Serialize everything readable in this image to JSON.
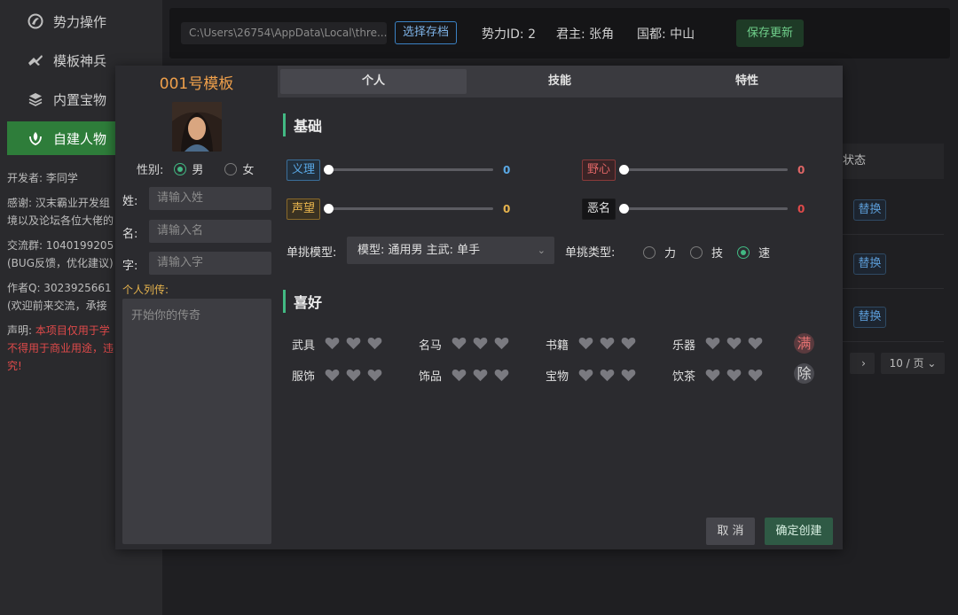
{
  "sidebar": {
    "items": [
      {
        "label": "势力操作",
        "icon": "faction-icon"
      },
      {
        "label": "模板神兵",
        "icon": "weapon-icon"
      },
      {
        "label": "内置宝物",
        "icon": "layers-icon"
      },
      {
        "label": "自建人物",
        "icon": "character-icon"
      }
    ],
    "developer": "开发者: 李同学",
    "thanks_1": "感谢: 汉末霸业开发组",
    "thanks_2": "境以及论坛各位大佬的",
    "group": "交流群:  1040199205",
    "group_note": "(BUG反馈，优化建议)",
    "author_qq": "作者Q: 3023925661",
    "author_note": "(欢迎前来交流，承接",
    "statement_label": "声明: ",
    "statement_1": "本项目仅用于学",
    "statement_2": "不得用于商业用途，违",
    "statement_3": "究!"
  },
  "topbar": {
    "path": "C:\\Users\\26754\\AppData\\Local\\thre...",
    "select_save_label": "选择存档",
    "faction_id": "势力ID:  2",
    "lord": "君主:  张角",
    "capital": "国都:  中山",
    "save_update_label": "保存更新"
  },
  "background_table": {
    "status_header": "状态",
    "replace_label": "替换",
    "page_size": "10 / 页"
  },
  "modal": {
    "title": "001号模板",
    "gender_label": "性别:",
    "gender_options": [
      "男",
      "女"
    ],
    "gender_selected": "男",
    "surname_label": "姓:",
    "surname_placeholder": "请输入姓",
    "given_name_label": "名:",
    "given_name_placeholder": "请输入名",
    "courtesy_label": "字:",
    "courtesy_placeholder": "请输入字",
    "bio_label": "个人列传:",
    "bio_placeholder": "开始你的传奇",
    "tabs": [
      "个人",
      "技能",
      "特性"
    ],
    "active_tab": "个人",
    "basic_section": "基础",
    "stats": [
      {
        "label": "义理",
        "value": "0",
        "color": "#5aa9e6"
      },
      {
        "label": "野心",
        "value": "0",
        "color": "#e06666"
      },
      {
        "label": "声望",
        "value": "0",
        "color": "#e6b34d"
      },
      {
        "label": "恶名",
        "value": "0",
        "color": "#e04a4a"
      }
    ],
    "duel_model_label": "单挑模型:",
    "duel_model_value": "模型: 通用男 主武: 单手",
    "duel_type_label": "单挑类型:",
    "duel_types": [
      "力",
      "技",
      "速"
    ],
    "duel_type_selected": "速",
    "hobby_section": "喜好",
    "hobbies": [
      "武具",
      "名马",
      "书籍",
      "乐器",
      "服饰",
      "饰品",
      "宝物",
      "饮茶"
    ],
    "fill_all_label": "满",
    "clear_label": "除",
    "cancel_label": "取 消",
    "confirm_label": "确定创建"
  },
  "colors": {
    "accent_green": "#42b983",
    "active_nav": "#2e7d3a",
    "title_orange": "#f0a04b"
  }
}
